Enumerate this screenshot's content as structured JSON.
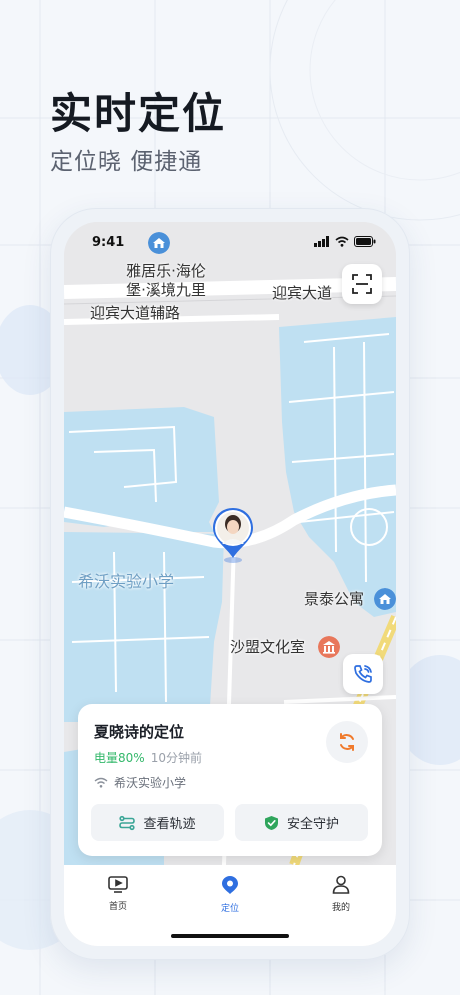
{
  "promo": {
    "headline": "实时定位",
    "subline": "定位晓 便捷通"
  },
  "status_bar": {
    "time": "9:41"
  },
  "map_labels": {
    "poi_yajule": "雅居乐·海伦\n堡·溪境九里",
    "road_yingbin": "迎宾大道",
    "road_yingbin_aux": "迎宾大道辅路",
    "school": "希沃实验小学",
    "apartment": "景泰公寓",
    "culture_room": "沙盟文化室"
  },
  "location_card": {
    "title": "夏晓诗的定位",
    "battery": "电量80%",
    "updated": "10分钟前",
    "place": "希沃实验小学",
    "track_button": "查看轨迹",
    "guard_button": "安全守护"
  },
  "tabbar": {
    "items": [
      {
        "label": "首页",
        "icon": "tv-play-icon",
        "active": false
      },
      {
        "label": "定位",
        "icon": "location-pin-icon",
        "active": true
      },
      {
        "label": "我的",
        "icon": "person-icon",
        "active": false
      }
    ]
  },
  "colors": {
    "accent": "#2f6fe0",
    "battery": "#34b86b",
    "refresh": "#f07a2c",
    "water": "#bfe0f2",
    "shield": "#2fa55c"
  }
}
